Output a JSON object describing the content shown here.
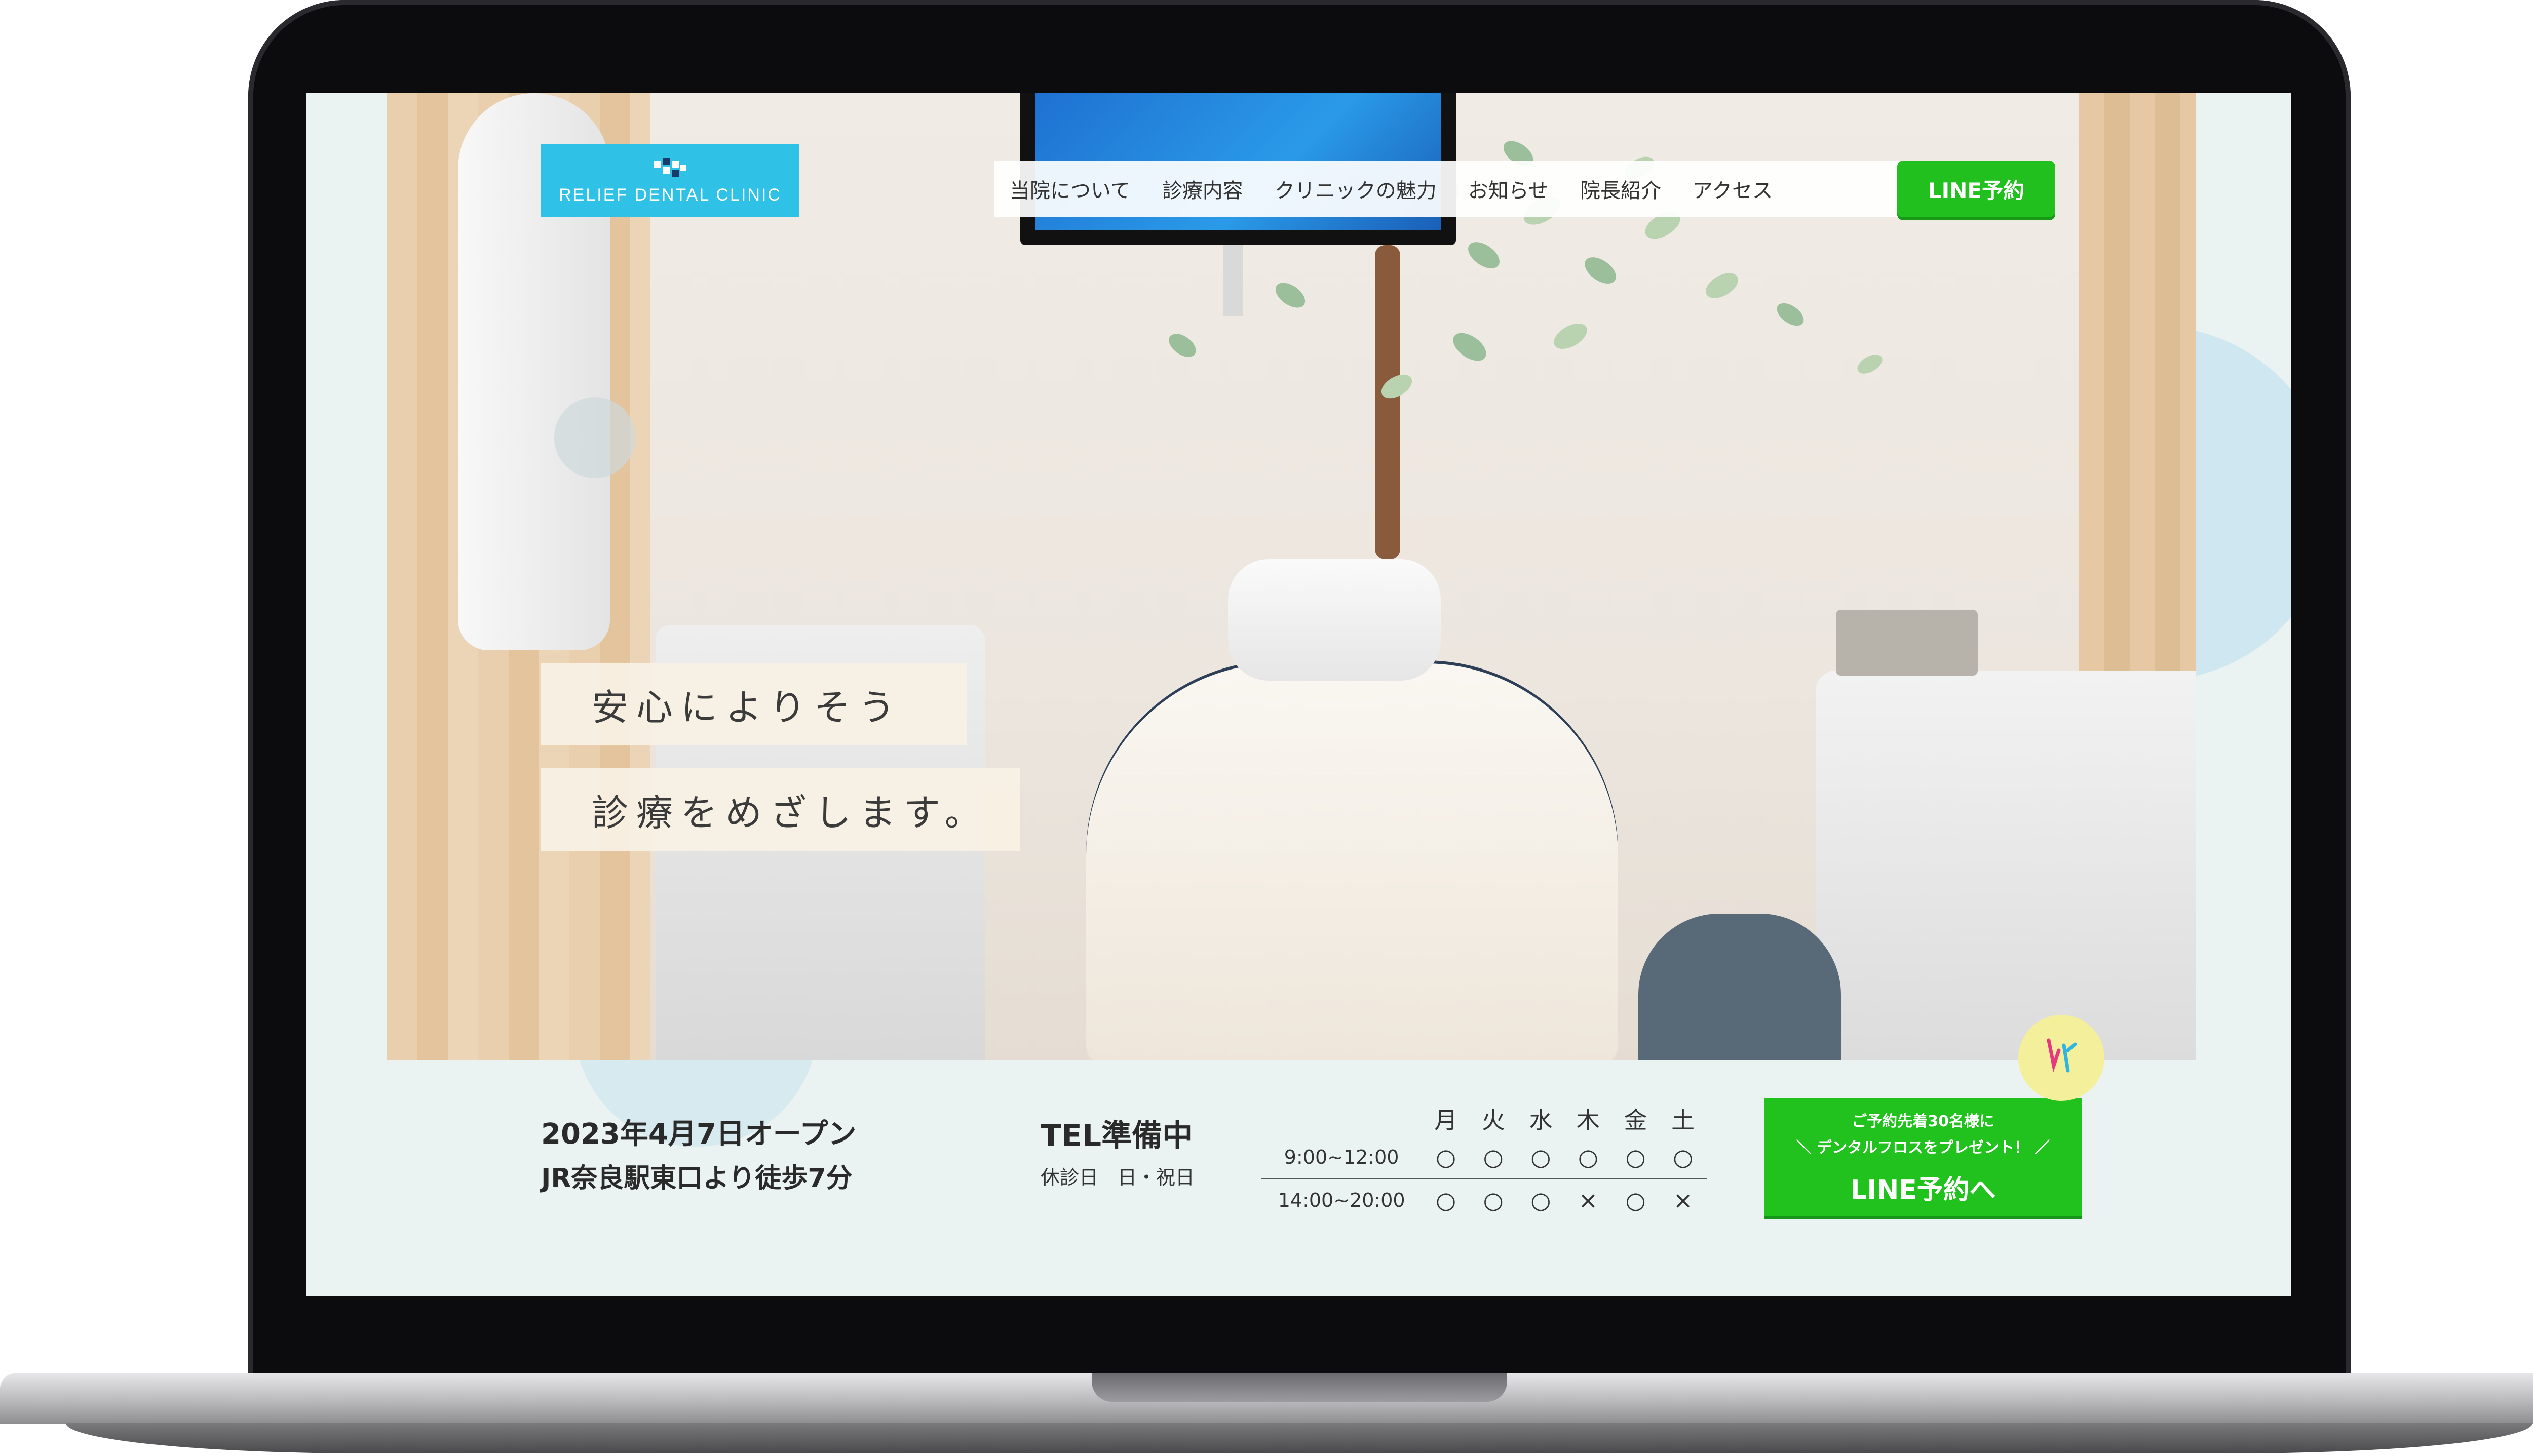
{
  "site": {
    "logo_text": "RELIEF DENTAL CLINIC",
    "brand_color": "#2fc1e6",
    "line_color": "#21c01f"
  },
  "nav": {
    "items": [
      "当院について",
      "診療内容",
      "クリニックの魅力",
      "お知らせ",
      "院長紹介",
      "アクセス"
    ],
    "line_button": "LINE予約"
  },
  "hero": {
    "catch_line1": "安心によりそう",
    "catch_line2": "診療をめざします。"
  },
  "info": {
    "open_date": "2023年4月7日オープン",
    "access": "JR奈良駅東口より徒歩7分",
    "tel": "TEL準備中",
    "closed_days": "休診日　日・祝日"
  },
  "hours": {
    "days": [
      "月",
      "火",
      "水",
      "木",
      "金",
      "土"
    ],
    "rows": [
      {
        "time": "9:00~12:00",
        "marks": [
          "○",
          "○",
          "○",
          "○",
          "○",
          "○"
        ]
      },
      {
        "time": "14:00~20:00",
        "marks": [
          "○",
          "○",
          "○",
          "×",
          "○",
          "×"
        ]
      }
    ]
  },
  "cta": {
    "sub_line1": "ご予約先着30名様に",
    "sub_line2": "＼ デンタルフロスをプレゼント！ ／",
    "main": "LINE予約へ",
    "floss_icon": "dental-floss-icon"
  }
}
